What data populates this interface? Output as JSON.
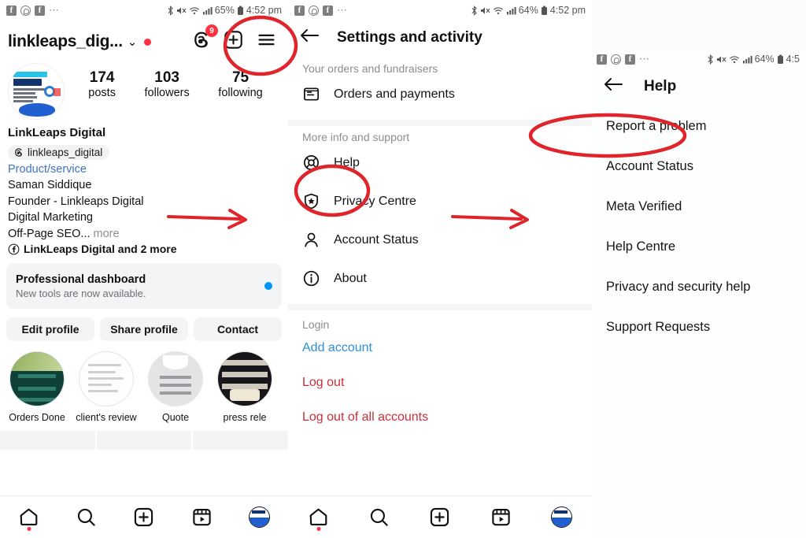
{
  "panels": {
    "profile": {
      "status_bar": {
        "icons": [
          "facebook-icon",
          "whatsapp-icon",
          "facebook-icon",
          "overflow-dots"
        ],
        "bluetooth": "bluetooth-icon",
        "mute": "mute-icon",
        "wifi": "wifi-icon",
        "signal": "signal-icon",
        "battery_text": "65%",
        "battery": "battery-icon",
        "time": "4:52 pm"
      },
      "header": {
        "username": "linkleaps_dig...",
        "chevron": "⌄",
        "threads_badge": "9"
      },
      "stats": [
        {
          "value": "174",
          "label": "posts"
        },
        {
          "value": "103",
          "label": "followers"
        },
        {
          "value": "75",
          "label": "following"
        }
      ],
      "bio": {
        "display_name": "LinkLeaps Digital",
        "threads_handle": "linkleaps_digital",
        "category": "Product/service",
        "lines": [
          "Saman Siddique",
          "Founder - Linkleaps Digital",
          "Digital Marketing"
        ],
        "last_line": "Off-Page SEO...",
        "more": " more",
        "pages": "LinkLeaps Digital and 2 more"
      },
      "dashboard": {
        "title": "Professional dashboard",
        "subtitle": "New tools are now available."
      },
      "buttons": [
        "Edit profile",
        "Share profile",
        "Contact"
      ],
      "highlights": [
        {
          "label": "Orders Done"
        },
        {
          "label": "client's review"
        },
        {
          "label": "Quote"
        },
        {
          "label": "press rele"
        }
      ],
      "bottom_nav": [
        "home-icon",
        "search-icon",
        "create-icon",
        "reels-icon",
        "profile-avatar"
      ]
    },
    "settings": {
      "status_bar": {
        "battery_text": "64%",
        "time": "4:52 pm"
      },
      "title": "Settings and activity",
      "back": "←",
      "sections": [
        {
          "label": "Your orders and fundraisers",
          "items": [
            {
              "label": "Orders and payments",
              "icon": "receipt-icon"
            }
          ]
        },
        {
          "label": "More info and support",
          "items": [
            {
              "label": "Help",
              "icon": "lifebuoy-icon"
            },
            {
              "label": "Privacy Centre",
              "icon": "shield-star-icon"
            },
            {
              "label": "Account Status",
              "icon": "person-icon"
            },
            {
              "label": "About",
              "icon": "info-icon"
            }
          ]
        },
        {
          "label": "Login",
          "items": [
            {
              "label": "Add account",
              "color": "#2f8fd6"
            },
            {
              "label": "Log out",
              "color": "#c62f3b"
            },
            {
              "label": "Log out of all accounts",
              "color": "#c62f3b"
            }
          ]
        }
      ],
      "bottom_nav": [
        "home-icon",
        "search-icon",
        "create-icon",
        "reels-icon",
        "profile-avatar"
      ]
    },
    "help": {
      "status_bar": {
        "battery_text": "64%",
        "time": "4:5"
      },
      "title": "Help",
      "back": "←",
      "items": [
        "Report a problem",
        "Account Status",
        "Meta Verified",
        "Help Centre",
        "Privacy and security help",
        "Support Requests"
      ]
    }
  },
  "annotations": {
    "color": "#e0242b",
    "circles": [
      "hamburger-menu",
      "help-row",
      "report-a-problem-row"
    ],
    "arrows": [
      "profile-to-settings",
      "settings-to-help"
    ]
  },
  "colors": {
    "accent_blue": "#0095f6",
    "link_blue": "#2f8fd6",
    "danger_red": "#c62f3b",
    "annotation_red": "#e0242b",
    "notification_red": "#ff3040"
  }
}
